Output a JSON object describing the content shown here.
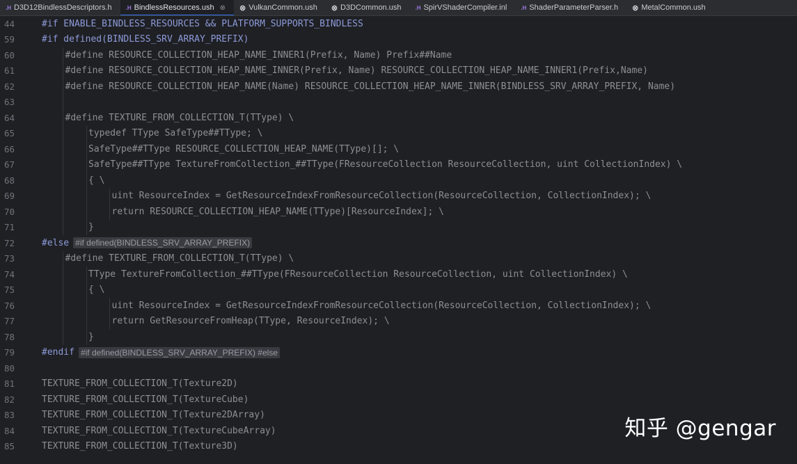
{
  "tabs": [
    {
      "icon": ".H",
      "icon_kind": "h",
      "label": "D3D12BindlessDescriptors.h",
      "active": false
    },
    {
      "icon": ".H",
      "icon_kind": "h",
      "label": "BindlessResources.ush",
      "active": true
    },
    {
      "icon": "⊗",
      "icon_kind": "ush",
      "label": "VulkanCommon.ush",
      "active": false
    },
    {
      "icon": "⊗",
      "icon_kind": "ush",
      "label": "D3DCommon.ush",
      "active": false
    },
    {
      "icon": ".H",
      "icon_kind": "h",
      "label": "SpirVShaderCompiler.inl",
      "active": false
    },
    {
      "icon": ".H",
      "icon_kind": "h",
      "label": "ShaderParameterParser.h",
      "active": false
    },
    {
      "icon": "⊗",
      "icon_kind": "ush",
      "label": "MetalCommon.ush",
      "active": false
    }
  ],
  "tab_close": "⊗",
  "lines": [
    {
      "num": "44",
      "text": "#if ENABLE_BINDLESS_RESOURCES && PLATFORM_SUPPORTS_BINDLESS",
      "indent": 0,
      "style": "kw"
    },
    {
      "num": "59",
      "text": "#if defined(BINDLESS_SRV_ARRAY_PREFIX)",
      "indent": 0,
      "style": "kw"
    },
    {
      "num": "60",
      "text": "#define RESOURCE_COLLECTION_HEAP_NAME_INNER1(Prefix, Name) Prefix##Name",
      "indent": 1,
      "style": "dim"
    },
    {
      "num": "61",
      "text": "#define RESOURCE_COLLECTION_HEAP_NAME_INNER(Prefix, Name) RESOURCE_COLLECTION_HEAP_NAME_INNER1(Prefix,Name)",
      "indent": 1,
      "style": "dim"
    },
    {
      "num": "62",
      "text": "#define RESOURCE_COLLECTION_HEAP_NAME(Name) RESOURCE_COLLECTION_HEAP_NAME_INNER(BINDLESS_SRV_ARRAY_PREFIX, Name)",
      "indent": 1,
      "style": "dim"
    },
    {
      "num": "63",
      "text": "",
      "indent": 0,
      "style": "dim"
    },
    {
      "num": "64",
      "text": "#define TEXTURE_FROM_COLLECTION_T(TType) \\",
      "indent": 1,
      "style": "dim"
    },
    {
      "num": "65",
      "text": "typedef TType SafeType##TType; \\",
      "indent": 2,
      "style": "dim"
    },
    {
      "num": "66",
      "text": "SafeType##TType RESOURCE_COLLECTION_HEAP_NAME(TType)[]; \\",
      "indent": 2,
      "style": "dim"
    },
    {
      "num": "67",
      "text": "SafeType##TType TextureFromCollection_##TType(FResourceCollection ResourceCollection, uint CollectionIndex) \\",
      "indent": 2,
      "style": "dim"
    },
    {
      "num": "68",
      "text": "{ \\",
      "indent": 2,
      "style": "dim"
    },
    {
      "num": "69",
      "text": "uint ResourceIndex = GetResourceIndexFromResourceCollection(ResourceCollection, CollectionIndex); \\",
      "indent": 3,
      "style": "dim"
    },
    {
      "num": "70",
      "text": "return RESOURCE_COLLECTION_HEAP_NAME(TType)[ResourceIndex]; \\",
      "indent": 3,
      "style": "dim"
    },
    {
      "num": "71",
      "text": "}",
      "indent": 2,
      "style": "dim"
    },
    {
      "num": "72",
      "text": "#else",
      "indent": 0,
      "style": "kw",
      "hint": "#if defined(BINDLESS_SRV_ARRAY_PREFIX)"
    },
    {
      "num": "73",
      "text": "#define TEXTURE_FROM_COLLECTION_T(TType) \\",
      "indent": 1,
      "style": "dim"
    },
    {
      "num": "74",
      "text": "TType TextureFromCollection_##TType(FResourceCollection ResourceCollection, uint CollectionIndex) \\",
      "indent": 2,
      "style": "dim"
    },
    {
      "num": "75",
      "text": "{ \\",
      "indent": 2,
      "style": "dim"
    },
    {
      "num": "76",
      "text": "uint ResourceIndex = GetResourceIndexFromResourceCollection(ResourceCollection, CollectionIndex); \\",
      "indent": 3,
      "style": "dim"
    },
    {
      "num": "77",
      "text": "return GetResourceFromHeap(TType, ResourceIndex); \\",
      "indent": 3,
      "style": "dim"
    },
    {
      "num": "78",
      "text": "}",
      "indent": 2,
      "style": "dim"
    },
    {
      "num": "79",
      "text": "#endif",
      "indent": 0,
      "style": "kw",
      "hint": "#if defined(BINDLESS_SRV_ARRAY_PREFIX) #else"
    },
    {
      "num": "80",
      "text": "",
      "indent": 0,
      "style": "dim"
    },
    {
      "num": "81",
      "text": "TEXTURE_FROM_COLLECTION_T(Texture2D)",
      "indent": 0,
      "style": "dim"
    },
    {
      "num": "82",
      "text": "TEXTURE_FROM_COLLECTION_T(TextureCube)",
      "indent": 0,
      "style": "dim"
    },
    {
      "num": "83",
      "text": "TEXTURE_FROM_COLLECTION_T(Texture2DArray)",
      "indent": 0,
      "style": "dim"
    },
    {
      "num": "84",
      "text": "TEXTURE_FROM_COLLECTION_T(TextureCubeArray)",
      "indent": 0,
      "style": "dim"
    },
    {
      "num": "85",
      "text": "TEXTURE_FROM_COLLECTION_T(Texture3D)",
      "indent": 0,
      "style": "dim"
    }
  ],
  "watermark": "知乎 @gengar",
  "colors": {
    "background": "#1f2024",
    "tabbar": "#2b2d30",
    "active_tab_underline": "#3574f0",
    "keyword": "#5e86d6",
    "dim_code": "#8c8f94",
    "line_number": "#6f737a"
  }
}
